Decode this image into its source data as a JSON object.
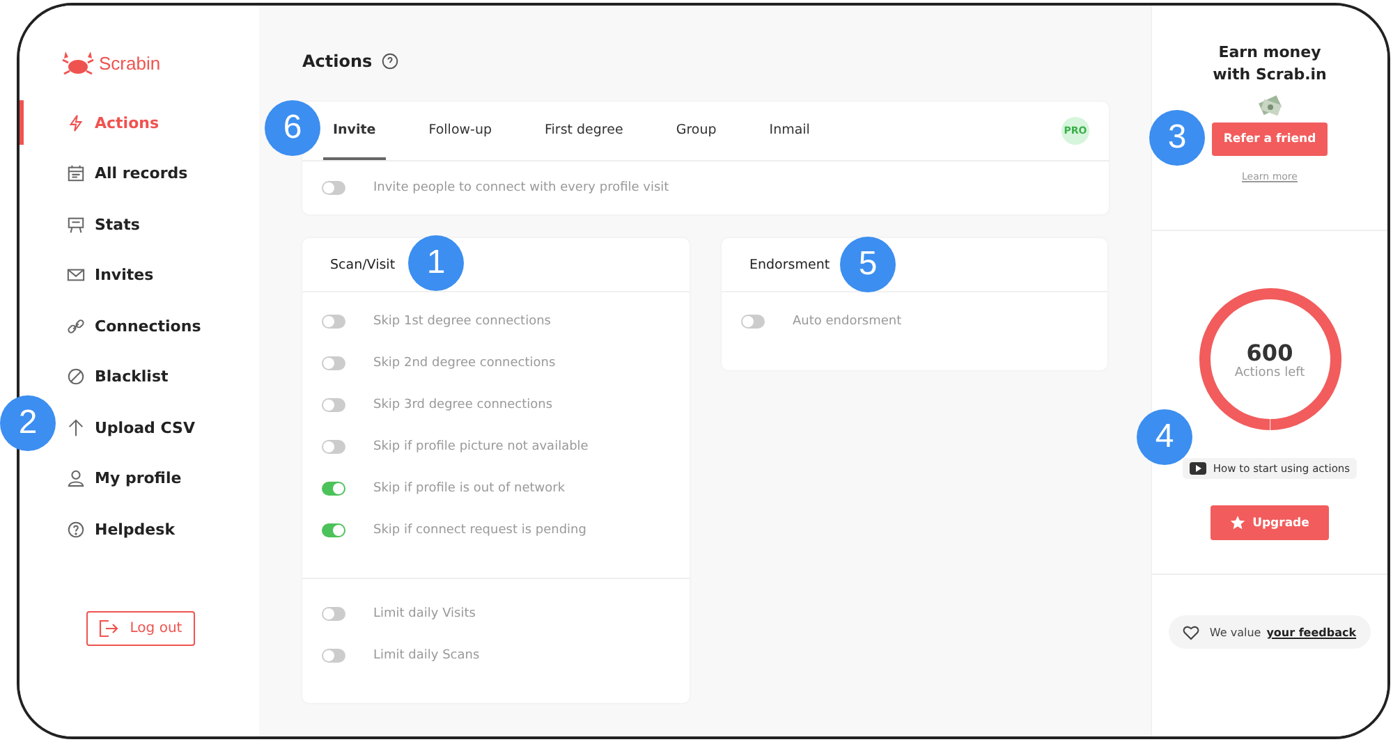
{
  "brand": "Scrabin",
  "sidebar": {
    "items": [
      {
        "label": "Actions",
        "selected": true
      },
      {
        "label": "All records",
        "selected": false
      },
      {
        "label": "Stats",
        "selected": false
      },
      {
        "label": "Invites",
        "selected": false
      },
      {
        "label": "Connections",
        "selected": false
      },
      {
        "label": "Blacklist",
        "selected": false
      },
      {
        "label": "Upload CSV",
        "selected": false
      },
      {
        "label": "My profile",
        "selected": false
      },
      {
        "label": "Helpdesk",
        "selected": false
      }
    ],
    "logout": "Log out"
  },
  "page_title": "Actions",
  "tabs": [
    {
      "label": "Invite",
      "selected": true
    },
    {
      "label": "Follow-up",
      "selected": false
    },
    {
      "label": "First degree",
      "selected": false
    },
    {
      "label": "Group",
      "selected": false
    },
    {
      "label": "Inmail",
      "selected": false
    }
  ],
  "pro_badge": "PRO",
  "invite_option": {
    "label": "Invite people to connect with every profile visit",
    "on": false
  },
  "scan_card": {
    "title": "Scan/Visit",
    "options": [
      {
        "label": "Skip 1st degree connections",
        "on": false
      },
      {
        "label": "Skip 2nd degree connections",
        "on": false
      },
      {
        "label": "Skip 3rd degree connections",
        "on": false
      },
      {
        "label": "Skip if profile picture not available",
        "on": false
      },
      {
        "label": "Skip if profile is out of network",
        "on": true
      },
      {
        "label": "Skip if connect request is pending",
        "on": true
      }
    ],
    "limits": [
      {
        "label": "Limit daily Visits",
        "on": false
      },
      {
        "label": "Limit daily Scans",
        "on": false
      }
    ]
  },
  "endorsment_card": {
    "title": "Endorsment",
    "options": [
      {
        "label": "Auto endorsment",
        "on": false
      }
    ]
  },
  "referral": {
    "title_lines": [
      "Earn money",
      "with Scrab.in"
    ],
    "button": "Refer a friend",
    "link": "Learn more"
  },
  "actions_meter": {
    "value": "600",
    "caption": "Actions left",
    "level": 1
  },
  "video_link": "How to start using actions",
  "upgrade_button": "Upgrade",
  "feedback": {
    "text": "We value",
    "link": "your feedback"
  },
  "callouts": [
    {
      "label": "1"
    },
    {
      "label": "2"
    },
    {
      "label": "3"
    },
    {
      "label": "4"
    },
    {
      "label": "5"
    },
    {
      "label": "6"
    }
  ]
}
